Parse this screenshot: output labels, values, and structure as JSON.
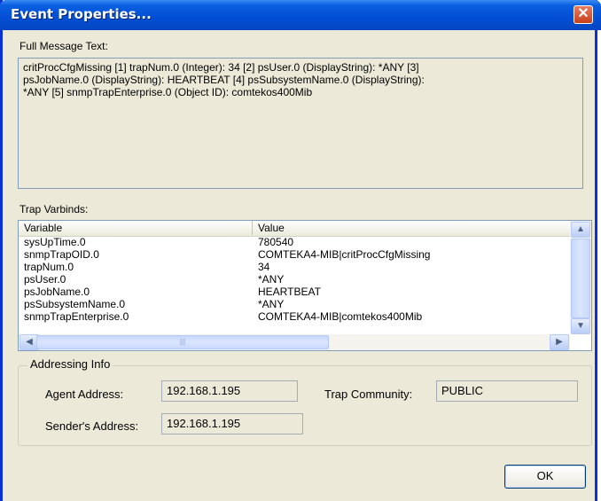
{
  "window": {
    "title": "Event Properties..."
  },
  "message": {
    "label": "Full Message Text:",
    "lines": [
      "critProcCfgMissing [1] trapNum.0 (Integer): 34 [2] psUser.0 (DisplayString): *ANY       [3]",
      "psJobName.0 (DisplayString): HEARTBEAT  [4] psSubsystemName.0 (DisplayString):",
      "*ANY                [5] snmpTrapEnterprise.0 (Object ID): comtekos400Mib"
    ]
  },
  "varbinds": {
    "label": "Trap Varbinds:",
    "columns": [
      "Variable",
      "Value"
    ],
    "rows": [
      [
        "sysUpTime.0",
        "780540"
      ],
      [
        "snmpTrapOID.0",
        "COMTEKA4-MIB|critProcCfgMissing"
      ],
      [
        "trapNum.0",
        "34"
      ],
      [
        "psUser.0",
        "*ANY"
      ],
      [
        "psJobName.0",
        "HEARTBEAT"
      ],
      [
        "psSubsystemName.0",
        "*ANY"
      ],
      [
        "snmpTrapEnterprise.0",
        "COMTEKA4-MIB|comtekos400Mib"
      ]
    ]
  },
  "addressing": {
    "title": "Addressing Info",
    "agent_label": "Agent Address:",
    "agent_value": "192.168.1.195",
    "community_label": "Trap Community:",
    "community_value": "PUBLIC",
    "sender_label": "Sender's Address:",
    "sender_value": "192.168.1.195"
  },
  "buttons": {
    "ok": "OK"
  }
}
